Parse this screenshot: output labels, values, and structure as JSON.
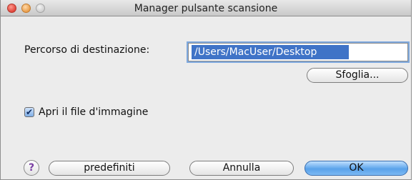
{
  "window": {
    "title": "Manager pulsante scansione"
  },
  "destination": {
    "label": "Percorso di destinazione:",
    "value": "/Users/MacUser/Desktop",
    "browse_label": "Sfoglia..."
  },
  "open_image": {
    "label": "Apri il file d'immagine",
    "checked": true,
    "check_glyph": "✔"
  },
  "footer": {
    "help_glyph": "?",
    "defaults_label": "predefiniti",
    "cancel_label": "Annulla",
    "ok_label": "OK"
  }
}
